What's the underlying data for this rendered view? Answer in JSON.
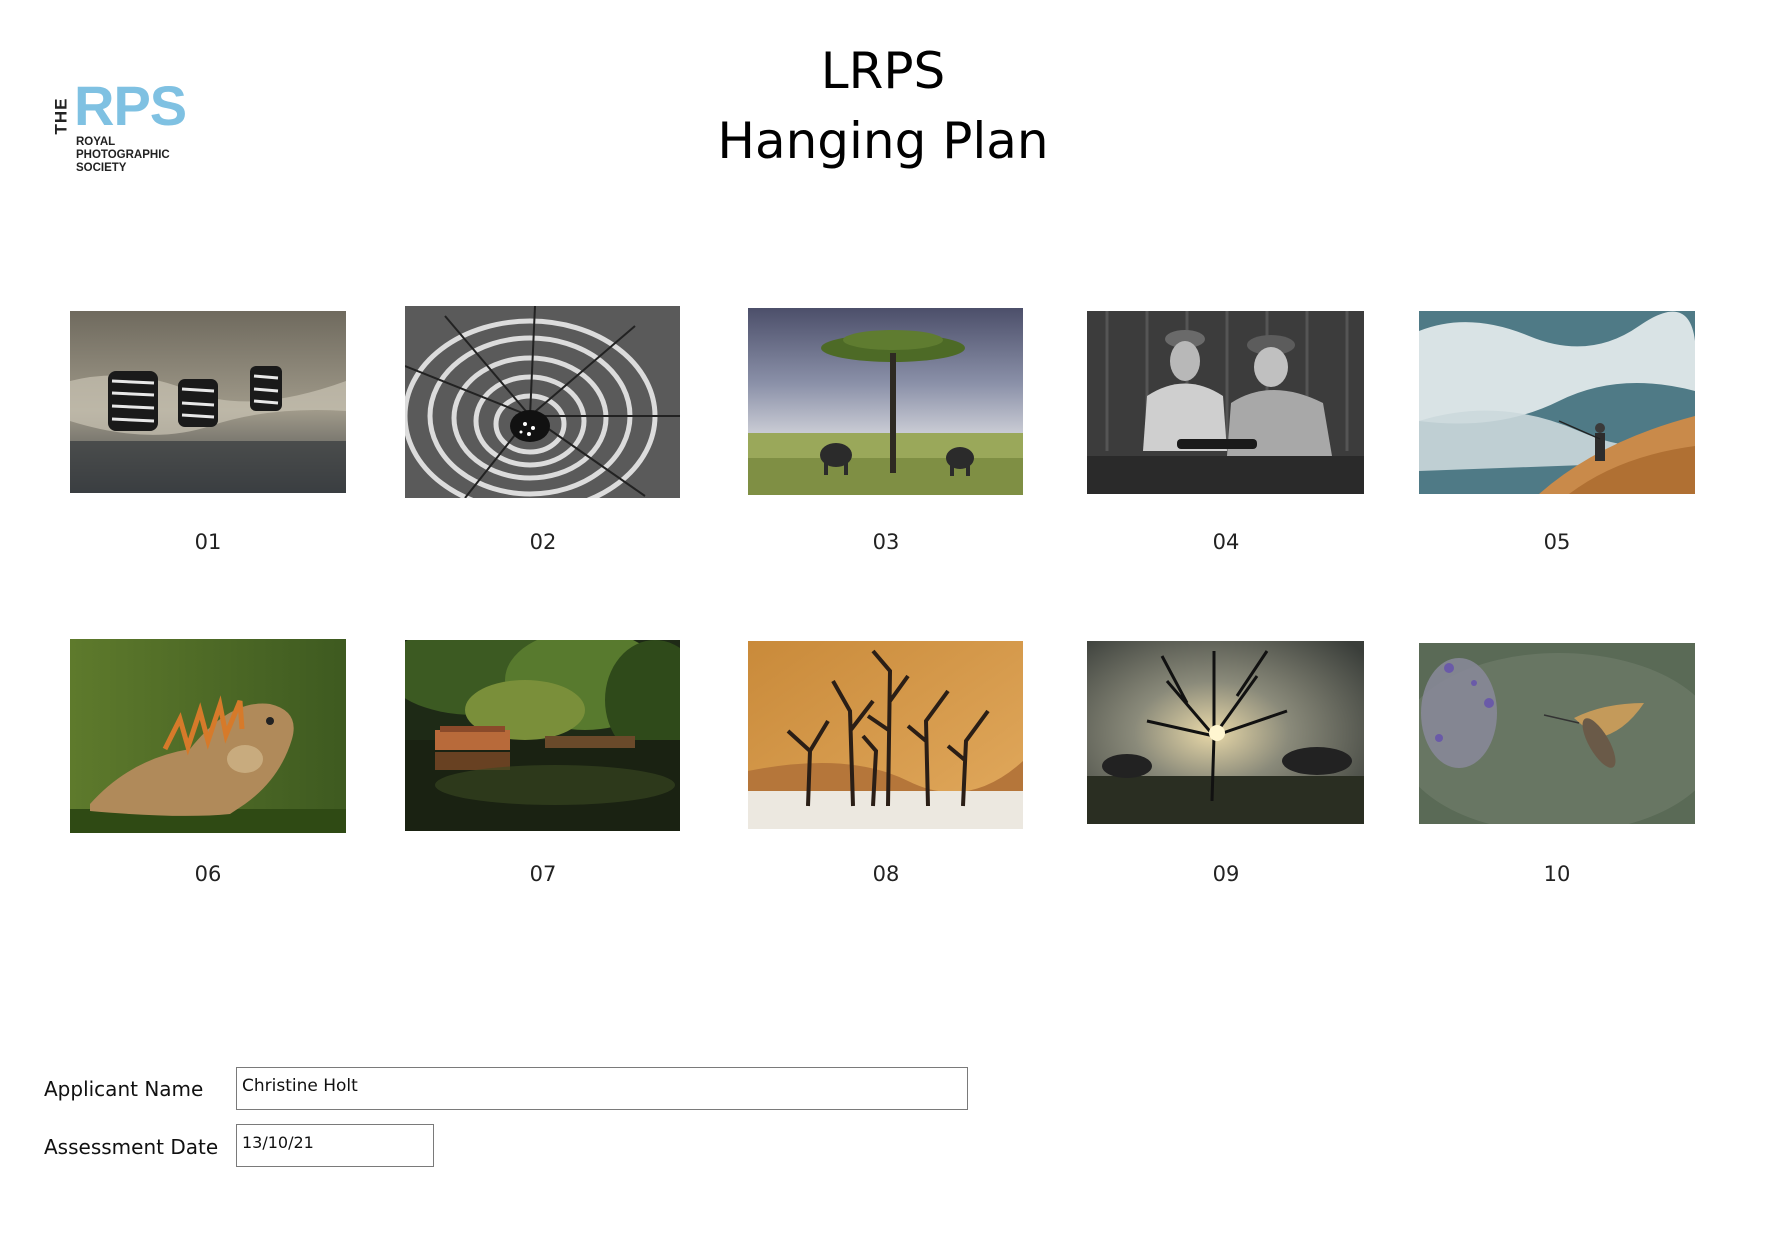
{
  "logo": {
    "the": "THE",
    "rps": "RPS",
    "line1": "ROYAL",
    "line2": "PHOTOGRAPHIC",
    "line3": "SOCIETY"
  },
  "title": {
    "line1": "LRPS",
    "line2": "Hanging Plan"
  },
  "images": [
    {
      "number": "01",
      "subject": "zebras crossing river",
      "icon": "zebras-photo"
    },
    {
      "number": "02",
      "subject": "spiral staircase",
      "icon": "spiral-staircase-photo"
    },
    {
      "number": "03",
      "subject": "acacia tree with elephants",
      "icon": "acacia-elephants-photo"
    },
    {
      "number": "04",
      "subject": "two men at table",
      "icon": "two-men-photo"
    },
    {
      "number": "05",
      "subject": "fisherman in surf",
      "icon": "fisherman-surf-photo"
    },
    {
      "number": "06",
      "subject": "iguana",
      "icon": "iguana-photo"
    },
    {
      "number": "07",
      "subject": "canal boat reflection",
      "icon": "canal-boat-photo"
    },
    {
      "number": "08",
      "subject": "dead trees in dunes",
      "icon": "dead-trees-photo"
    },
    {
      "number": "09",
      "subject": "tree silhouette at sunrise",
      "icon": "tree-sunrise-photo"
    },
    {
      "number": "10",
      "subject": "hummingbird hawk moth",
      "icon": "hawk-moth-photo"
    }
  ],
  "form": {
    "applicant_label": "Applicant Name",
    "applicant_value": "Christine Holt",
    "date_label": "Assessment Date",
    "date_value": "13/10/21"
  }
}
